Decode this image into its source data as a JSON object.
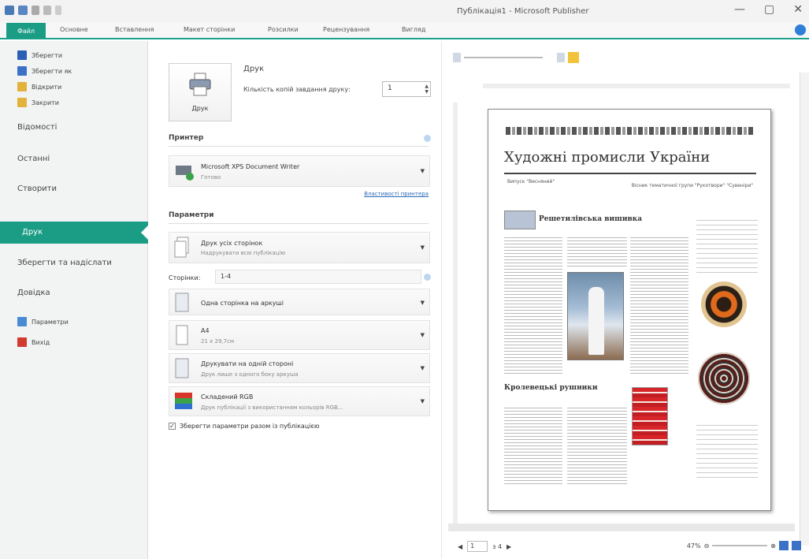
{
  "window": {
    "title": "Публікація1 - Microsoft Publisher",
    "controls": [
      "—",
      "▢",
      "✕"
    ]
  },
  "ribbon": {
    "file_tab": "Файл",
    "tabs": [
      "Основне",
      "Вставлення",
      "Макет сторінки",
      "Розсилки",
      "Рецензування",
      "Вигляд"
    ]
  },
  "nav": {
    "small_items": [
      {
        "label": "Зберегти",
        "icon": "save-icon",
        "color": "#2b5fb5"
      },
      {
        "label": "Зберегти як",
        "icon": "save-as-icon",
        "color": "#3b72c8"
      },
      {
        "label": "Відкрити",
        "icon": "open-folder-icon",
        "color": "#e2b23c"
      },
      {
        "label": "Закрити",
        "icon": "close-folder-icon",
        "color": "#e2b23c"
      }
    ],
    "big_items": [
      "Відомості",
      "Останні",
      "Створити"
    ],
    "active": "Друк",
    "lower_items": [
      "Зберегти та надіслати",
      "Довідка"
    ],
    "bottom_items": [
      {
        "label": "Параметри",
        "icon": "options-icon",
        "color": "#4a8bd4"
      },
      {
        "label": "Вихід",
        "icon": "exit-icon",
        "color": "#d23b2f"
      }
    ]
  },
  "print": {
    "button_label": "Друк",
    "heading": "Друк",
    "copies_label": "Кількість копій завдання друку:",
    "copies_value": "1",
    "printer_heading": "Принтер",
    "printer_name": "Microsoft XPS Document Writer",
    "printer_status": "Готово",
    "printer_properties": "Властивості принтера",
    "settings_heading": "Параметри",
    "pages_label": "Сторінки:",
    "pages_value": "1-4",
    "options": [
      {
        "title": "Друк усіх сторінок",
        "subtitle": "Надрукувати всю публікацію"
      },
      {
        "title": "Одна сторінка на аркуші",
        "subtitle": ""
      },
      {
        "title": "A4",
        "subtitle": "21 x 29,7см"
      },
      {
        "title": "Друкувати на одній стороні",
        "subtitle": "Друк лише з одного боку аркуша"
      },
      {
        "title": "Складений RGB",
        "subtitle": "Друк публікації з використанням кольорів RGB..."
      }
    ],
    "save_settings_label": "Зберегти параметри разом із публікацією",
    "save_settings_checked": true
  },
  "preview": {
    "page_current": "1",
    "page_of": "з 4",
    "zoom": "47%",
    "pub_title": "Художні промисли України",
    "pub_issue": "Випуск \"Весняний\"",
    "pub_subtitle": "Вісник тематичної групи \"Рукотвори\" \"Сувеніри\"",
    "article1_title": "Решетилівська вишивка",
    "article2_title": "Кролевецькі рушники"
  }
}
